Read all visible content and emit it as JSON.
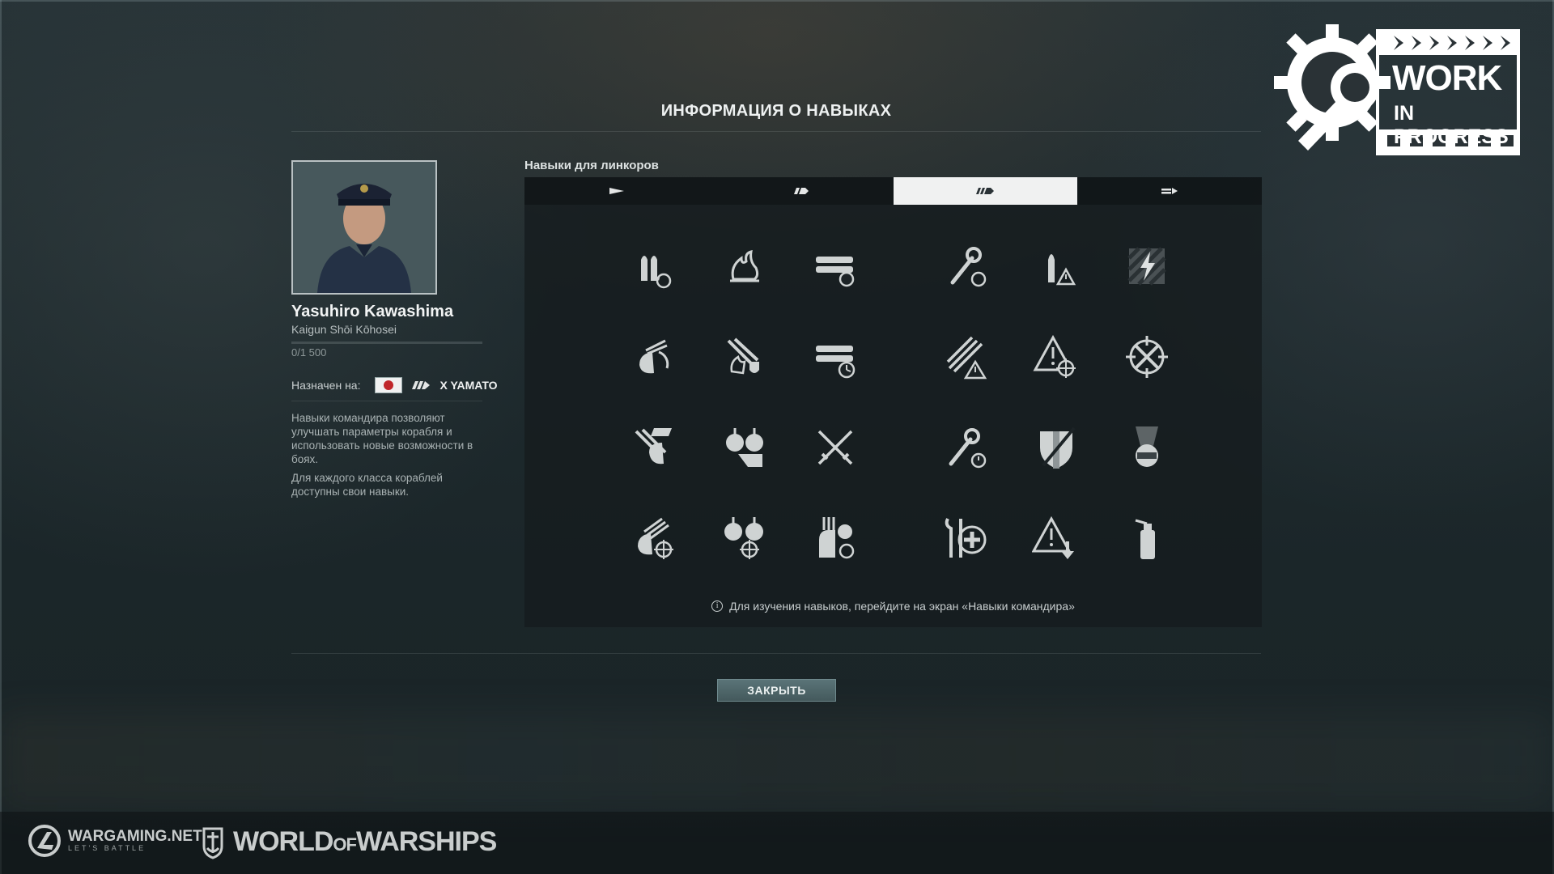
{
  "dialog": {
    "title": "ИНФОРМАЦИЯ О НАВЫКАХ",
    "close_label": "ЗАКРЫТЬ"
  },
  "commander": {
    "name": "Yasuhiro Kawashima",
    "rank": "Kaigun Shōi Kōhosei",
    "xp": "0/1 500",
    "xp_progress": 0,
    "assigned_label": "Назначен на:",
    "ship_name": "X YAMATO",
    "description_1": "Навыки командира позволяют улучшать параметры корабля и использовать новые возможности в боях.",
    "description_2": "Для каждого класса кораблей доступны свои навыки."
  },
  "skills": {
    "heading": "Навыки для линкоров",
    "tabs": [
      {
        "icon": "destroyer-class-icon",
        "active": false
      },
      {
        "icon": "cruiser-class-icon",
        "active": false
      },
      {
        "icon": "battleship-class-icon",
        "active": true
      },
      {
        "icon": "aircraft-carrier-class-icon",
        "active": false
      }
    ],
    "grid_icons": [
      [
        "shells-reload-icon",
        "fire-icon",
        "torpedo-reload-icon",
        "wrench-reload-icon",
        "shell-warning-icon",
        "lightning-priority-icon"
      ],
      [
        "secondary-turret-reload-icon",
        "fire-extinguish-icon",
        "torpedo-timer-icon",
        "barrels-warning-icon",
        "warning-crosshair-icon",
        "anti-air-crosshair-icon"
      ],
      [
        "flag-turret-icon",
        "anti-air-guns-icon",
        "crossed-swords-icon",
        "wrench-timer-icon",
        "armor-shield-icon",
        "turret-beam-icon"
      ],
      [
        "secondary-crosshair-icon",
        "anti-air-crosshair-guns-icon",
        "turret-reload-icon",
        "repair-heal-icon",
        "warning-down-icon",
        "extinguisher-icon"
      ]
    ],
    "hint": "Для изучения навыков, перейдите на экран «Навыки командира»"
  },
  "badge": {
    "line1": "WORK",
    "line2": "IN PROGRESS"
  },
  "footer": {
    "wargaming": "WARGAMING.NET",
    "wargaming_tagline": "LET'S BATTLE",
    "wows_world": "WORLD",
    "wows_of": "OF",
    "wows_warships": "WARSHIPS"
  }
}
